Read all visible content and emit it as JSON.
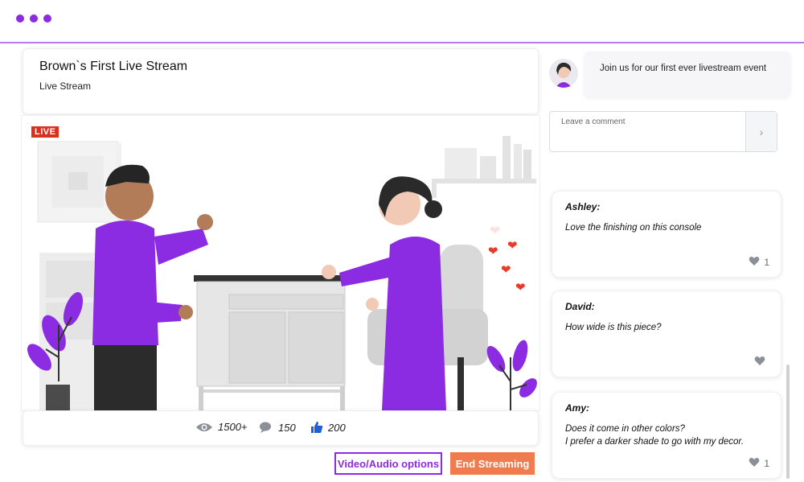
{
  "window": {
    "controls": [
      "dot",
      "dot",
      "dot"
    ],
    "accent": "#8b2be2"
  },
  "stream": {
    "title": "Brown`s First Live Stream",
    "subtitle": "Live Stream",
    "live_badge": "LIVE"
  },
  "stats": {
    "views": "1500+",
    "comments": "150",
    "likes": "200",
    "icons": [
      "eye-icon",
      "comment-icon",
      "thumbs-up-icon"
    ]
  },
  "buttons": {
    "video_audio": "Video/Audio options",
    "end_streaming": "End Streaming",
    "end_color": "#f07b4e"
  },
  "host_message": {
    "text": "Join us for our first ever livestream event"
  },
  "comment_input": {
    "placeholder": "Leave a comment",
    "send_icon": "chevron-right-icon"
  },
  "chat": [
    {
      "name": "Ashley:",
      "lines": [
        "Love the finishing on this console"
      ],
      "likes": "1"
    },
    {
      "name": "David:",
      "lines": [
        "How wide is this piece?"
      ],
      "likes": ""
    },
    {
      "name": "Amy:",
      "lines": [
        "Does it come in other colors?",
        "I prefer a darker shade to go with my decor."
      ],
      "likes": "1"
    }
  ]
}
